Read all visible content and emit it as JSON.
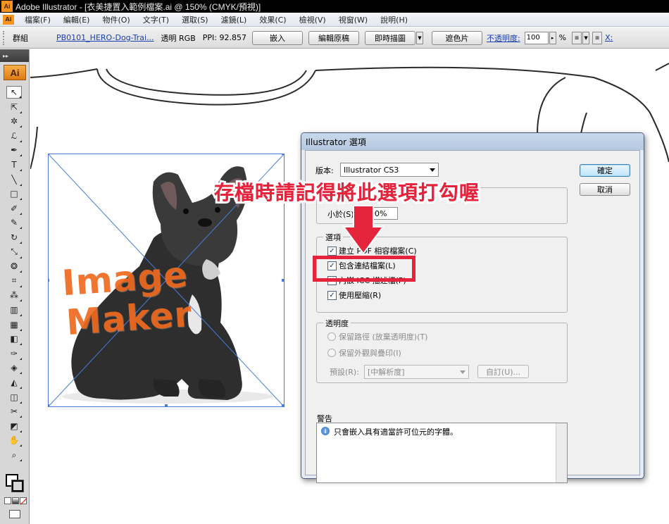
{
  "window": {
    "app_icon": "Ai",
    "title": "Adobe Illustrator - [衣美捷置入範例檔案.ai @ 150% (CMYK/預視)]"
  },
  "menu": {
    "ai_icon": "Ai",
    "items": [
      "檔案(F)",
      "編輯(E)",
      "物件(O)",
      "文字(T)",
      "選取(S)",
      "濾鏡(L)",
      "效果(C)",
      "檢視(V)",
      "視窗(W)",
      "說明(H)"
    ]
  },
  "controlbar": {
    "group_label": "群組",
    "file_link": "PB0101_HERO-Dog-Trai...",
    "transparency": "透明 RGB",
    "ppi": "PPI: 92.857",
    "embed_button": "嵌入",
    "edit_original_button": "編輯原稿",
    "live_trace_button": "即時描圖",
    "mask_button": "遮色片",
    "opacity_label": "不透明度:",
    "opacity_value": "100",
    "percent": "%",
    "x_label": "X:"
  },
  "toolbox": {
    "header": "▸▸",
    "logo": "Ai",
    "tools": [
      {
        "name": "selection-tool-icon",
        "glyph": "↖"
      },
      {
        "name": "direct-selection-tool-icon",
        "glyph": "⇱"
      },
      {
        "name": "magic-wand-tool-icon",
        "glyph": "✲"
      },
      {
        "name": "lasso-tool-icon",
        "glyph": "ℒ"
      },
      {
        "name": "pen-tool-icon",
        "glyph": "✒"
      },
      {
        "name": "type-tool-icon",
        "glyph": "T"
      },
      {
        "name": "line-tool-icon",
        "glyph": "╲"
      },
      {
        "name": "rectangle-tool-icon",
        "glyph": "□"
      },
      {
        "name": "paintbrush-tool-icon",
        "glyph": "✐"
      },
      {
        "name": "pencil-tool-icon",
        "glyph": "✎"
      },
      {
        "name": "rotate-tool-icon",
        "glyph": "↻"
      },
      {
        "name": "scale-tool-icon",
        "glyph": "⤡"
      },
      {
        "name": "warp-tool-icon",
        "glyph": "❂"
      },
      {
        "name": "free-transform-tool-icon",
        "glyph": "⌗"
      },
      {
        "name": "symbol-sprayer-tool-icon",
        "glyph": "⁂"
      },
      {
        "name": "column-graph-tool-icon",
        "glyph": "▥"
      },
      {
        "name": "mesh-tool-icon",
        "glyph": "▦"
      },
      {
        "name": "gradient-tool-icon",
        "glyph": "◧"
      },
      {
        "name": "eyedropper-tool-icon",
        "glyph": "✑"
      },
      {
        "name": "blend-tool-icon",
        "glyph": "◈"
      },
      {
        "name": "live-paint-bucket-tool-icon",
        "glyph": "◭"
      },
      {
        "name": "live-paint-selection-tool-icon",
        "glyph": "◫"
      },
      {
        "name": "slice-tool-icon",
        "glyph": "✂"
      },
      {
        "name": "eraser-tool-icon",
        "glyph": "◩"
      },
      {
        "name": "hand-tool-icon",
        "glyph": "✋"
      },
      {
        "name": "zoom-tool-icon",
        "glyph": "⌕"
      }
    ]
  },
  "canvas": {
    "watermark_line1": "Image",
    "watermark_line2": "Maker"
  },
  "dialog": {
    "title": "Illustrator 選項",
    "version_label": "版本:",
    "version_value": "Illustrator CS3",
    "subset_label": "小於(S):",
    "subset_value": "100%",
    "ok_button": "確定",
    "cancel_button": "取消",
    "options_group": "選項",
    "options": [
      {
        "label": "建立 PDF 相容檔案(C)",
        "checked": true
      },
      {
        "label": "包含連結檔案(L)",
        "checked": true
      },
      {
        "label": "內嵌 ICC 描述檔(P)",
        "checked": true
      },
      {
        "label": "使用壓縮(R)",
        "checked": true
      }
    ],
    "transparency_group": "透明度",
    "transparency_options": [
      "保留路徑 (放棄透明度)(T)",
      "保留外觀與疊印(I)"
    ],
    "preset_label": "預設(R):",
    "preset_value": "[中解析度]",
    "custom_button": "自訂(U)...",
    "warning_group": "警告",
    "warning_text": "只會嵌入具有適當許可位元的字體。",
    "info_icon": "i"
  },
  "annotation": {
    "text": "存檔時請記得將此選項打勾喔",
    "color": "#e5243c"
  }
}
